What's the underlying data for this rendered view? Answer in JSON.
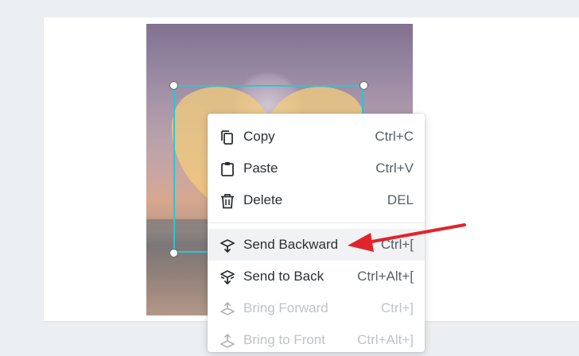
{
  "context_menu": {
    "items": [
      {
        "label": "Copy",
        "shortcut": "Ctrl+C",
        "icon": "copy-icon",
        "enabled": true
      },
      {
        "label": "Paste",
        "shortcut": "Ctrl+V",
        "icon": "paste-icon",
        "enabled": true
      },
      {
        "label": "Delete",
        "shortcut": "DEL",
        "icon": "trash-icon",
        "enabled": true
      },
      {
        "label": "Send Backward",
        "shortcut": "Ctrl+[",
        "icon": "send-backward-icon",
        "enabled": true,
        "highlighted": true
      },
      {
        "label": "Send to Back",
        "shortcut": "Ctrl+Alt+[",
        "icon": "send-to-back-icon",
        "enabled": true
      },
      {
        "label": "Bring Forward",
        "shortcut": "Ctrl+]",
        "icon": "bring-forward-icon",
        "enabled": false
      },
      {
        "label": "Bring to Front",
        "shortcut": "Ctrl+Alt+]",
        "icon": "bring-to-front-icon",
        "enabled": false
      }
    ]
  },
  "colors": {
    "selection_border": "#2fc4d2",
    "arrow": "#e0242b",
    "heart_fill": "#f7cf7a",
    "menu_hover": "#f1f2f4",
    "canvas_background": "#eceff2"
  }
}
